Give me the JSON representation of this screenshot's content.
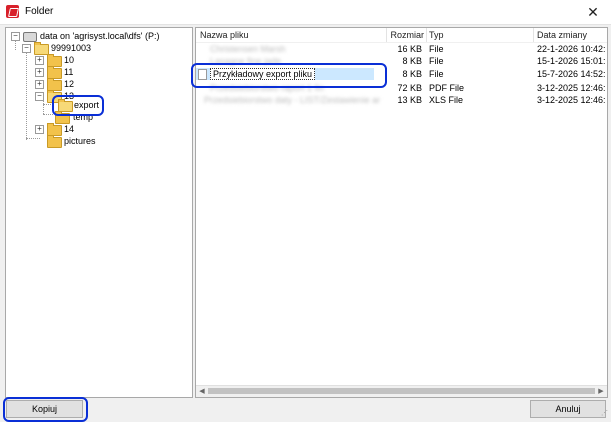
{
  "window": {
    "title": "Folder",
    "close_glyph": "✕"
  },
  "tree": {
    "root": "data on 'agrisyst.local\\dfs' (P:)",
    "items": [
      {
        "label": "99991003"
      },
      {
        "label": "10"
      },
      {
        "label": "11"
      },
      {
        "label": "12"
      },
      {
        "label": "13"
      },
      {
        "label": "export"
      },
      {
        "label": "temp"
      },
      {
        "label": "14"
      },
      {
        "label": "pictures"
      }
    ],
    "expander_plus": "+",
    "expander_minus": "−"
  },
  "file_list": {
    "columns": [
      "Nazwa pliku",
      "Rozmiar",
      "Typ",
      "Data zmiany"
    ],
    "rows": [
      {
        "name": "Christensen Marsh",
        "size": "16 KB",
        "type": "File",
        "date": "22-1-2026 10:42:"
      },
      {
        "name": "Lasagne fine jade",
        "size": "8 KB",
        "type": "File",
        "date": "15-1-2026 15:01:"
      },
      {
        "name": "Przykładowy export pliku",
        "size": "8 KB",
        "type": "File",
        "date": "15-7-2026 14:52:"
      },
      {
        "name": "Przedsiebiorstwo raport 1 fin",
        "size": "72 KB",
        "type": "PDF File",
        "date": "3-12-2025 12:46:"
      },
      {
        "name": "Przedsiebiorstwo daty - LIST/Zestawienie arkusz",
        "size": "13 KB",
        "type": "XLS File",
        "date": "3-12-2025 12:46:"
      }
    ]
  },
  "scrollbar": {
    "left_arrow": "◀",
    "right_arrow": "▶"
  },
  "buttons": {
    "copy": "Kopiuj",
    "cancel": "Anuluj"
  },
  "colors": {
    "highlight": "#0a2fd6",
    "selection": "#cce8ff",
    "folder": "#f2c24b"
  }
}
